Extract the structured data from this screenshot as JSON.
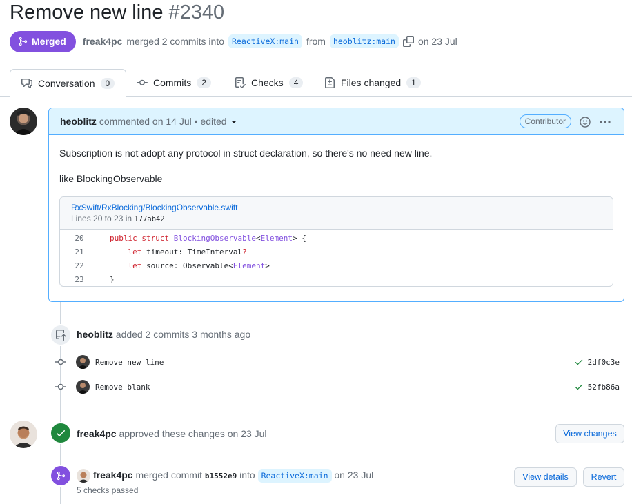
{
  "pr": {
    "title": "Remove new line",
    "number": "#2340",
    "state": "Merged",
    "author": "freak4pc",
    "merge_text": "merged 2 commits into",
    "base_branch": "ReactiveX:main",
    "from_text": "from",
    "head_branch": "heoblitz:main",
    "date_text": "on 23 Jul"
  },
  "tabs": [
    {
      "label": "Conversation",
      "count": "0"
    },
    {
      "label": "Commits",
      "count": "2"
    },
    {
      "label": "Checks",
      "count": "4"
    },
    {
      "label": "Files changed",
      "count": "1"
    }
  ],
  "comment": {
    "author": "heoblitz",
    "meta": "commented on 14 Jul • edited",
    "role": "Contributor",
    "body_1": "Subscription is not adopt any protocol in struct declaration, so there's no need new line.",
    "body_2": "like BlockingObservable",
    "snippet_path": "RxSwift/RxBlocking/BlockingObservable.swift",
    "snippet_lines_prefix": "Lines 20 to 23 in",
    "snippet_sha": "177ab42",
    "code": [
      {
        "ln": "20"
      },
      {
        "ln": "21"
      },
      {
        "ln": "22"
      },
      {
        "ln": "23"
      }
    ]
  },
  "commits_event": {
    "author": "heoblitz",
    "text": "added 2 commits 3 months ago",
    "commits": [
      {
        "message": "Remove new line",
        "sha": "2df0c3e"
      },
      {
        "message": "Remove blank",
        "sha": "52fb86a"
      }
    ]
  },
  "approval": {
    "author": "freak4pc",
    "text": "approved these changes on 23 Jul",
    "button": "View changes"
  },
  "merge_event": {
    "author": "freak4pc",
    "text1": "merged commit",
    "sha": "b1552e9",
    "text2": "into",
    "branch": "ReactiveX:main",
    "date": "on 23 Jul",
    "checks": "5 checks passed",
    "view_button": "View details",
    "revert_button": "Revert"
  },
  "colors": {
    "merged": "#8250df",
    "approved": "#1f883d",
    "link": "#0969da"
  }
}
